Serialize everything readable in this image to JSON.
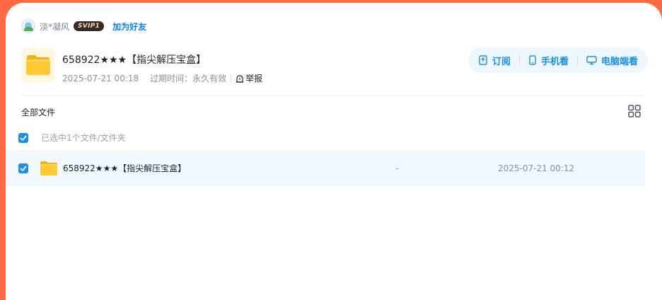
{
  "user": {
    "name": "淡*凝风",
    "badge": "SVIP1",
    "add_friend": "加为好友"
  },
  "share": {
    "title": "658922★★★【指尖解压宝盒】",
    "date": "2025-07-21 00:18",
    "expire": "过期时间：永久有效",
    "report": "举报"
  },
  "actions": {
    "subscribe": "订阅",
    "mobile": "手机看",
    "pc": "电脑端看"
  },
  "breadcrumb": "全部文件",
  "selection_text": "已选中1个文件/文件夹",
  "files": [
    {
      "name": "658922★★★【指尖解压宝盒】",
      "size": "-",
      "modified": "2025-07-21 00:12",
      "selected": true
    }
  ],
  "colors": {
    "accent": "#1a8fe3",
    "page_bg": "#ff6a45",
    "row_highlight": "#f1f8fe",
    "folder": "#ffc933"
  }
}
